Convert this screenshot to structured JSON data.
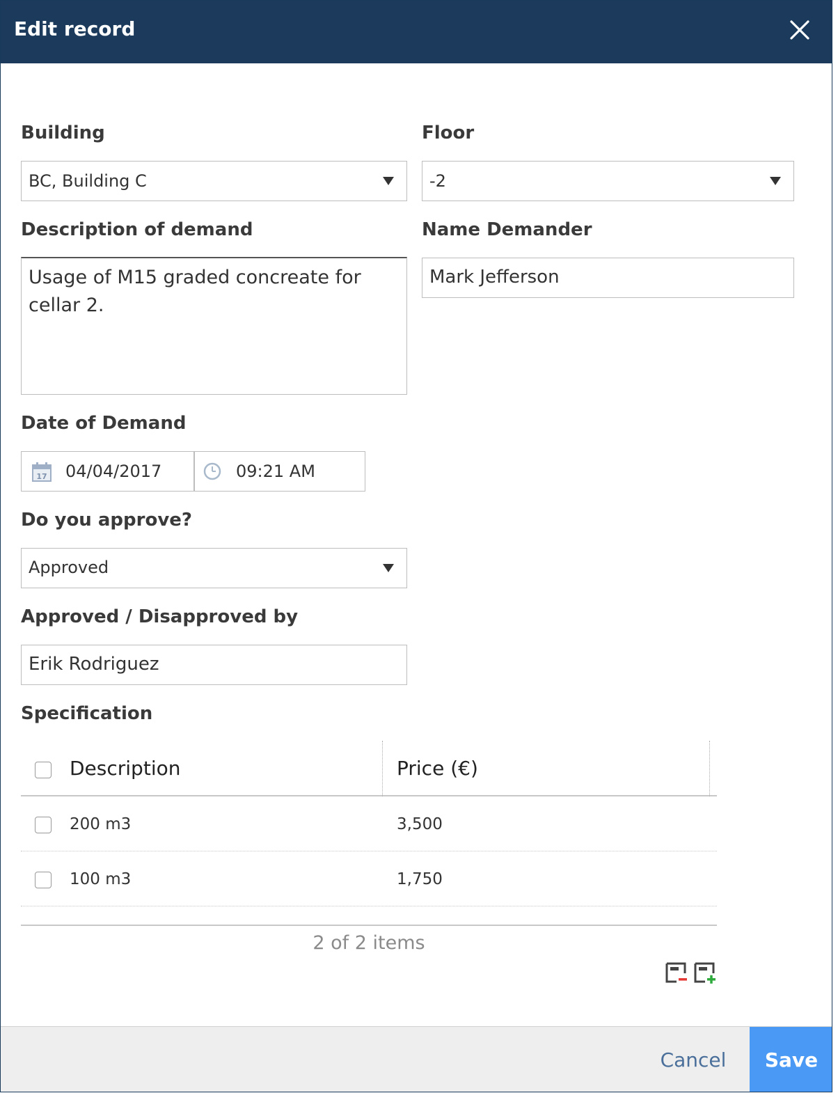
{
  "dialog": {
    "title": "Edit record",
    "header_color": "#1b3a5c"
  },
  "form": {
    "building": {
      "label": "Building",
      "value": "BC, Building C"
    },
    "floor": {
      "label": "Floor",
      "value": "-2"
    },
    "description": {
      "label": "Description of demand",
      "value": "Usage of M15 graded concreate for cellar 2."
    },
    "name_demander": {
      "label": "Name Demander",
      "value": "Mark Jefferson"
    },
    "date_of_demand": {
      "label": "Date of Demand",
      "date": "04/04/2017",
      "time": "09:21 AM",
      "calendar_day": "17"
    },
    "approve": {
      "label": "Do you approve?",
      "value": "Approved"
    },
    "approved_by": {
      "label": "Approved / Disapproved by",
      "value": "Erik Rodriguez"
    }
  },
  "specification": {
    "label": "Specification",
    "columns": [
      "Description",
      "Price (€)"
    ],
    "rows": [
      {
        "description": "200 m3",
        "price": "3,500"
      },
      {
        "description": "100 m3",
        "price": "1,750"
      }
    ],
    "pager": "2 of 2 items"
  },
  "footer": {
    "cancel_label": "Cancel",
    "save_label": "Save",
    "save_color": "#4a9af5"
  }
}
